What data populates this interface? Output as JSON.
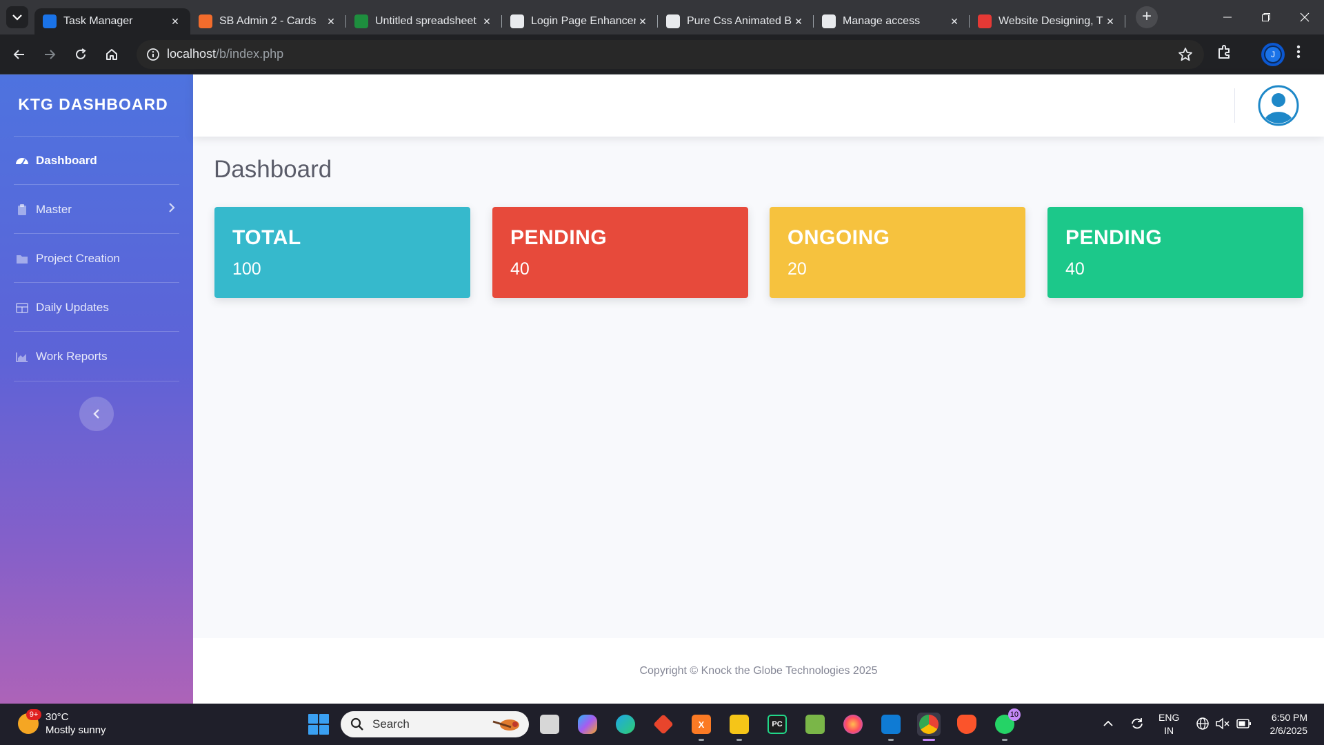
{
  "browser": {
    "tabs": [
      {
        "title": "Task Manager",
        "active": true,
        "favicon_color": "#1a73e8"
      },
      {
        "title": "SB Admin 2 - Cards",
        "active": false,
        "favicon_color": "#f26c2c"
      },
      {
        "title": "Untitled spreadsheet",
        "active": false,
        "favicon_color": "#1e8e3e"
      },
      {
        "title": "Login Page Enhancer",
        "active": false,
        "favicon_color": "#e8eaed"
      },
      {
        "title": "Pure Css Animated B",
        "active": false,
        "favicon_color": "#e8eaed"
      },
      {
        "title": "Manage access",
        "active": false,
        "favicon_color": "#e8eaed"
      },
      {
        "title": "Website Designing, T",
        "active": false,
        "favicon_color": "#e53935"
      }
    ],
    "address": {
      "host": "localhost",
      "path": "/b/index.php"
    },
    "profile_initial": "J"
  },
  "sidebar": {
    "brand": "KTG DASHBOARD",
    "items": [
      {
        "label": "Dashboard",
        "icon": "tachometer-icon",
        "active": true
      },
      {
        "label": "Master",
        "icon": "clipboard-icon",
        "active": false,
        "has_submenu": true
      },
      {
        "label": "Project Creation",
        "icon": "folder-icon",
        "active": false
      },
      {
        "label": "Daily Updates",
        "icon": "table-icon",
        "active": false
      },
      {
        "label": "Work Reports",
        "icon": "chart-area-icon",
        "active": false
      }
    ]
  },
  "main": {
    "page_title": "Dashboard",
    "cards": [
      {
        "title": "TOTAL",
        "value": "100",
        "color": "#36b9cc"
      },
      {
        "title": "PENDING",
        "value": "40",
        "color": "#e74a3b"
      },
      {
        "title": "ONGOING",
        "value": "20",
        "color": "#f6c23e"
      },
      {
        "title": "PENDING",
        "value": "40",
        "color": "#1cc88a"
      }
    ]
  },
  "footer": {
    "text": "Copyright © Knock the Globe Technologies 2025"
  },
  "taskbar": {
    "weather": {
      "temp": "30°C",
      "desc": "Mostly sunny",
      "badge": "9+"
    },
    "search_placeholder": "Search",
    "whatsapp_badge": "10",
    "lang": {
      "line1": "ENG",
      "line2": "IN"
    },
    "clock": {
      "time": "6:50 PM",
      "date": "2/6/2025"
    }
  }
}
